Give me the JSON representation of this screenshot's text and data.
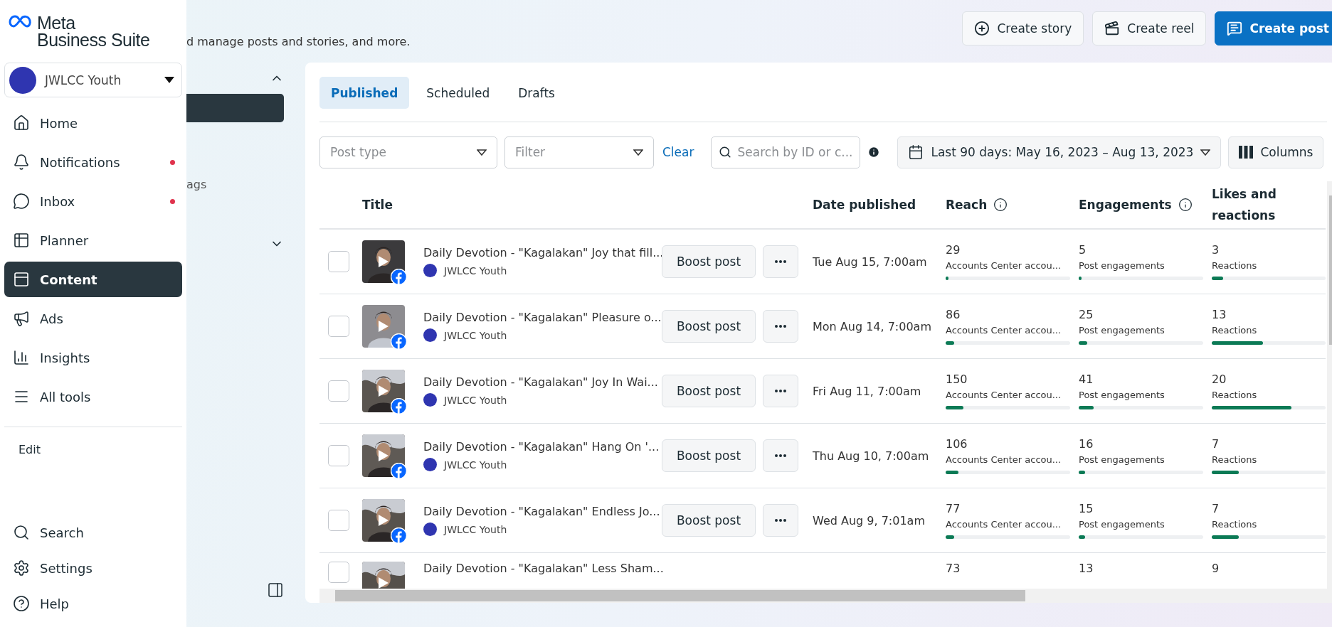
{
  "sidebar": {
    "logo": {
      "brand": "Meta",
      "product": "Business Suite"
    },
    "account": {
      "name": "JWLCC Youth"
    },
    "items": [
      {
        "kind": "home",
        "label": "Home",
        "selected": false,
        "dot": false
      },
      {
        "kind": "bell",
        "label": "Notifications",
        "selected": false,
        "dot": true
      },
      {
        "kind": "chat",
        "label": "Inbox",
        "selected": false,
        "dot": true
      },
      {
        "kind": "planner",
        "label": "Planner",
        "selected": false,
        "dot": false
      },
      {
        "kind": "content",
        "label": "Content",
        "selected": true,
        "dot": false
      },
      {
        "kind": "ads",
        "label": "Ads",
        "selected": false,
        "dot": false
      },
      {
        "kind": "insights",
        "label": "Insights",
        "selected": false,
        "dot": false
      },
      {
        "kind": "tools",
        "label": "All tools",
        "selected": false,
        "dot": false
      }
    ],
    "edit": "Edit",
    "bottom": [
      {
        "kind": "search",
        "label": "Search"
      },
      {
        "kind": "settings",
        "label": "Settings"
      },
      {
        "kind": "help",
        "label": "Help"
      }
    ]
  },
  "behind": {
    "subtitle": "d manage posts and stories, and more.",
    "fragment": "ags"
  },
  "actions": [
    {
      "kind": "story",
      "label": "Create story",
      "primary": false
    },
    {
      "kind": "reel",
      "label": "Create reel",
      "primary": false
    },
    {
      "kind": "post",
      "label": "Create post",
      "primary": true
    }
  ],
  "tabs": [
    {
      "label": "Published",
      "selected": true
    },
    {
      "label": "Scheduled",
      "selected": false
    },
    {
      "label": "Drafts",
      "selected": false
    }
  ],
  "filters": {
    "post_type": {
      "placeholder": "Post type"
    },
    "filter": {
      "placeholder": "Filter"
    },
    "clear": "Clear",
    "search": {
      "placeholder": "Search by ID or c..."
    },
    "date_range": "Last 90 days: May 16, 2023 – Aug 13, 2023",
    "columns": "Columns"
  },
  "table": {
    "columns": [
      {
        "label": "Title",
        "info": false
      },
      {
        "label": "Date published",
        "info": false
      },
      {
        "label": "Reach",
        "info": true
      },
      {
        "label": "Engagements",
        "info": true
      },
      {
        "label": "Likes and reactions",
        "info": false
      }
    ],
    "rows": [
      {
        "checked": false,
        "title": "Daily Devotion - \"Kagalakan\" Joy that fill...",
        "page": "JWLCC Youth",
        "boost": "Boost post",
        "date": "Tue Aug 15, 7:00am",
        "metrics": [
          {
            "value": "29",
            "caption": "Accounts Center accou...",
            "level": 0.02
          },
          {
            "value": "5",
            "caption": "Post engagements",
            "level": 0.02
          },
          {
            "value": "3",
            "caption": "Reactions",
            "level": 0.1
          }
        ]
      },
      {
        "checked": false,
        "title": "Daily Devotion - \"Kagalakan\" Pleasure o...",
        "page": "JWLCC Youth",
        "boost": "Boost post",
        "date": "Mon Aug 14, 7:00am",
        "metrics": [
          {
            "value": "86",
            "caption": "Accounts Center accou...",
            "level": 0.07
          },
          {
            "value": "25",
            "caption": "Post engagements",
            "level": 0.07
          },
          {
            "value": "13",
            "caption": "Reactions",
            "level": 0.45
          }
        ]
      },
      {
        "checked": false,
        "title": "Daily Devotion - \"Kagalakan\" Joy In Wai...",
        "page": "JWLCC Youth",
        "boost": "Boost post",
        "date": "Fri Aug 11, 7:00am",
        "metrics": [
          {
            "value": "150",
            "caption": "Accounts Center accou...",
            "level": 0.14
          },
          {
            "value": "41",
            "caption": "Post engagements",
            "level": 0.12
          },
          {
            "value": "20",
            "caption": "Reactions",
            "level": 0.7
          }
        ]
      },
      {
        "checked": false,
        "title": "Daily Devotion - \"Kagalakan\" Hang On '...",
        "page": "JWLCC Youth",
        "boost": "Boost post",
        "date": "Thu Aug 10, 7:00am",
        "metrics": [
          {
            "value": "106",
            "caption": "Accounts Center accou...",
            "level": 0.1
          },
          {
            "value": "16",
            "caption": "Post engagements",
            "level": 0.05
          },
          {
            "value": "7",
            "caption": "Reactions",
            "level": 0.24
          }
        ]
      },
      {
        "checked": false,
        "title": "Daily Devotion - \"Kagalakan\" Endless Jo...",
        "page": "JWLCC Youth",
        "boost": "Boost post",
        "date": "Wed Aug 9, 7:01am",
        "metrics": [
          {
            "value": "77",
            "caption": "Accounts Center accou...",
            "level": 0.07
          },
          {
            "value": "15",
            "caption": "Post engagements",
            "level": 0.05
          },
          {
            "value": "7",
            "caption": "Reactions",
            "level": 0.24
          }
        ]
      },
      {
        "checked": false,
        "title": "Daily Devotion - \"Kagalakan\" Less Sham...",
        "metrics": [
          {
            "value": "73"
          },
          {
            "value": "13"
          },
          {
            "value": "9"
          }
        ]
      }
    ]
  }
}
